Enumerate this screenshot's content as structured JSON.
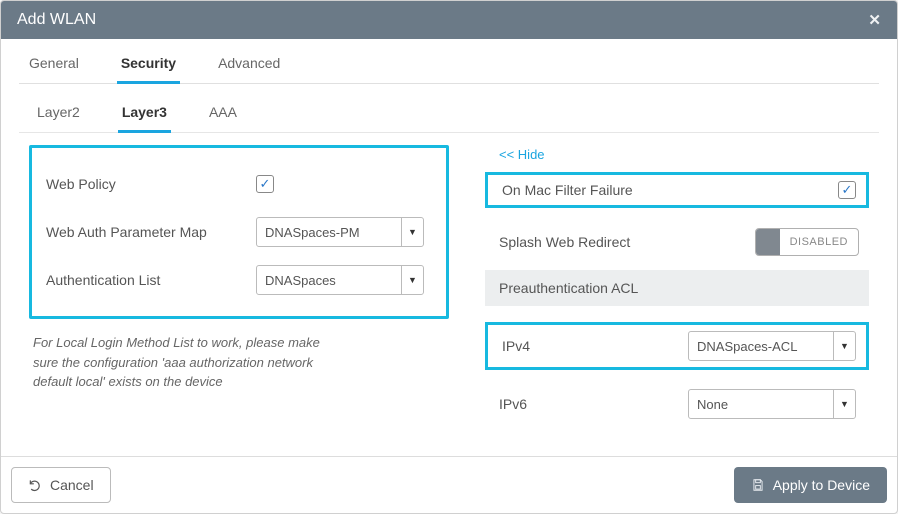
{
  "header": {
    "title": "Add WLAN",
    "close_icon": "✕"
  },
  "tabs_primary": [
    {
      "label": "General"
    },
    {
      "label": "Security"
    },
    {
      "label": "Advanced"
    }
  ],
  "tabs_secondary": [
    {
      "label": "Layer2"
    },
    {
      "label": "Layer3"
    },
    {
      "label": "AAA"
    }
  ],
  "left": {
    "web_policy_label": "Web Policy",
    "web_auth_param_label": "Web Auth Parameter Map",
    "web_auth_param_value": "DNASpaces-PM",
    "auth_list_label": "Authentication List",
    "auth_list_value": "DNASpaces",
    "note": "For Local Login Method List to work, please make sure the configuration 'aaa authorization network default local' exists on the device"
  },
  "right": {
    "hide_link": "<< Hide",
    "mac_filter_label": "On Mac Filter Failure",
    "splash_label": "Splash Web Redirect",
    "splash_toggle": "DISABLED",
    "preauth_header": "Preauthentication ACL",
    "ipv4_label": "IPv4",
    "ipv4_value": "DNASpaces-ACL",
    "ipv6_label": "IPv6",
    "ipv6_value": "None"
  },
  "footer": {
    "cancel_label": "Cancel",
    "apply_label": "Apply to Device"
  },
  "glyphs": {
    "check": "✓",
    "caret": "▼"
  }
}
